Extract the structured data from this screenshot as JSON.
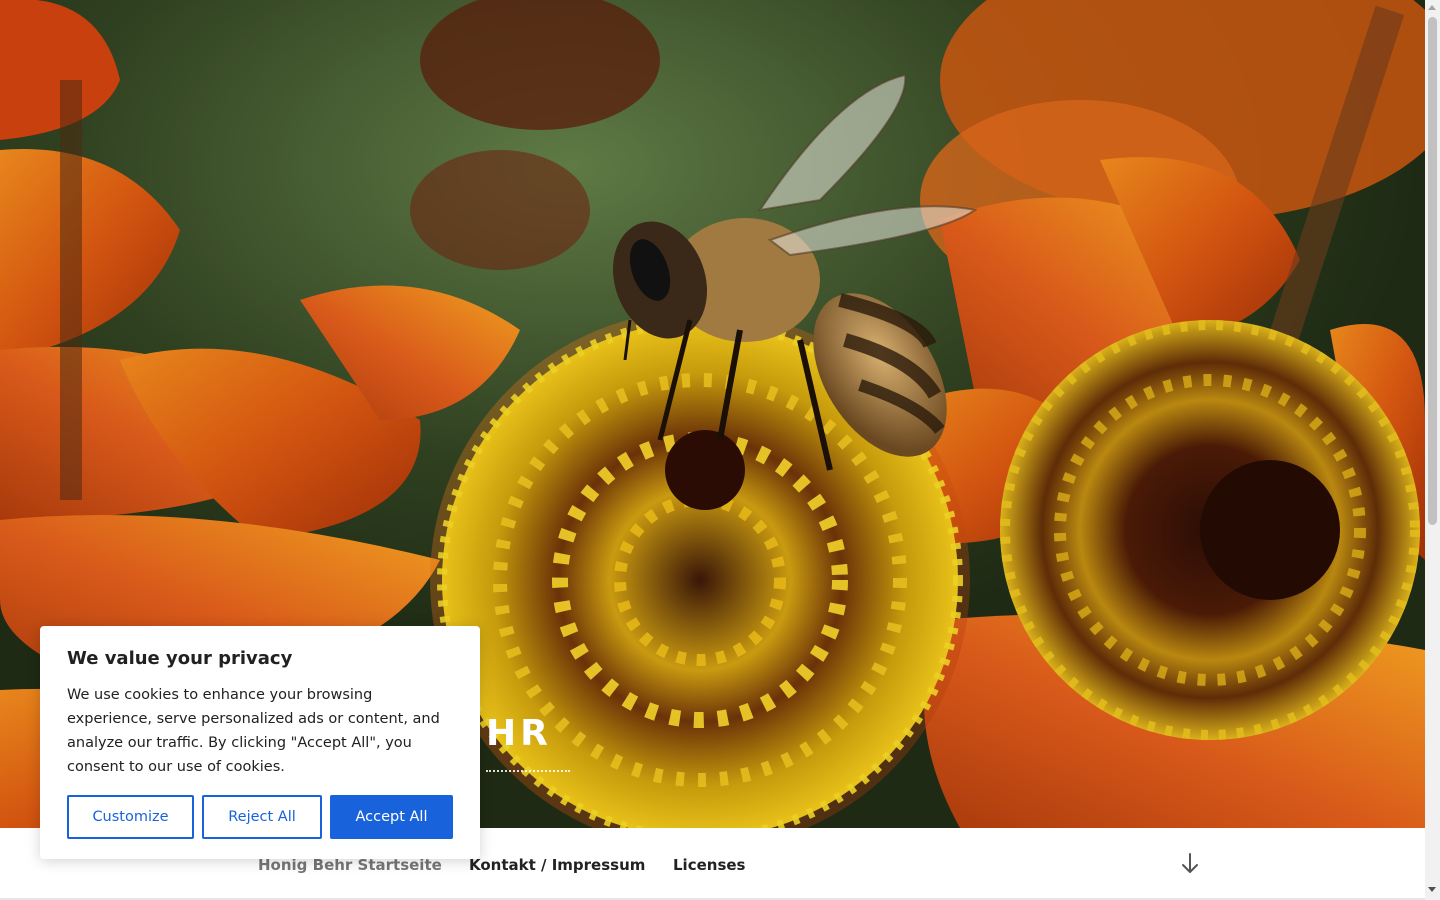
{
  "hero": {
    "site_title": "HONIG BEHR",
    "site_title_visible": "HR"
  },
  "nav": {
    "items": [
      {
        "label": "Honig Behr Startseite",
        "current": true
      },
      {
        "label": "Kontakt / Impressum",
        "current": false
      },
      {
        "label": "Licenses",
        "current": false
      }
    ],
    "scroll_icon": "arrow-down-icon"
  },
  "cookie_banner": {
    "title": "We value your privacy",
    "text": "We use cookies to enhance your browsing experience, serve personalized ads or content, and analyze our traffic. By clicking \"Accept All\", you consent to our use of cookies.",
    "buttons": {
      "customize": "Customize",
      "reject": "Reject All",
      "accept": "Accept All"
    }
  },
  "colors": {
    "accent": "#1863dc",
    "nav_current": "#767676",
    "nav_text": "#222222"
  }
}
